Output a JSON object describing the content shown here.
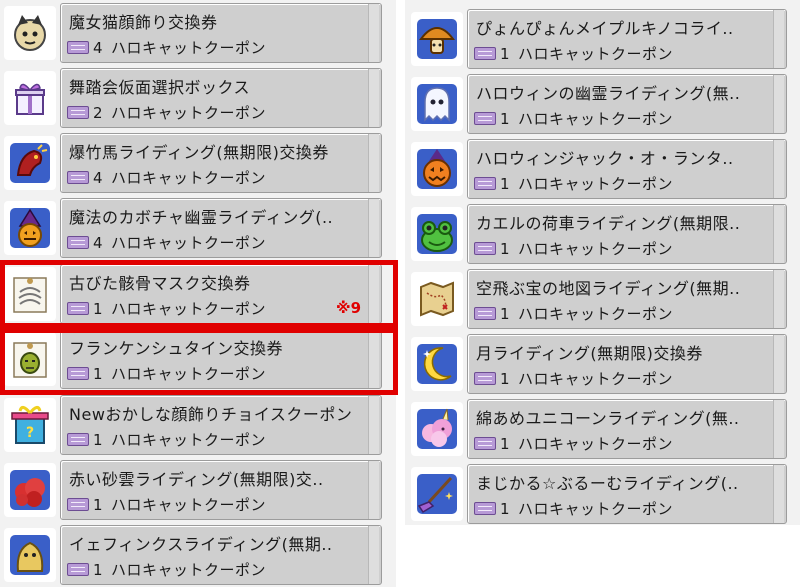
{
  "left_column": {
    "items": [
      {
        "name": "魔女猫顔飾り交換券",
        "qty": "4",
        "currency": "ハロキャットクーポン",
        "icon": "cat-face-icon"
      },
      {
        "name": "舞踏会仮面選択ボックス",
        "qty": "2",
        "currency": "ハロキャットクーポン",
        "icon": "gift-box-icon"
      },
      {
        "name": "爆竹馬ライディング(無期限)交換券",
        "qty": "4",
        "currency": "ハロキャットクーポン",
        "icon": "firecracker-horse-icon"
      },
      {
        "name": "魔法のカボチャ幽霊ライディング(..",
        "qty": "4",
        "currency": "ハロキャットクーポン",
        "icon": "pumpkin-ghost-icon"
      },
      {
        "name": "古びた骸骨マスク交換券",
        "qty": "1",
        "currency": "ハロキャットクーポン",
        "icon": "skull-ticket-icon"
      },
      {
        "name": "フランケンシュタイン交換券",
        "qty": "1",
        "currency": "ハロキャットクーポン",
        "icon": "frankenstein-ticket-icon"
      },
      {
        "name": "Newおかしな顔飾りチョイスクーポン",
        "qty": "1",
        "currency": "ハロキャットクーポン",
        "icon": "mystery-box-icon"
      },
      {
        "name": "赤い砂雲ライディング(無期限)交..",
        "qty": "1",
        "currency": "ハロキャットクーポン",
        "icon": "red-cloud-icon"
      },
      {
        "name": "イェフィンクスライディング(無期..",
        "qty": "1",
        "currency": "ハロキャットクーポン",
        "icon": "sphinx-icon"
      }
    ]
  },
  "right_column": {
    "items": [
      {
        "name": "ぴょんぴょんメイプルキノコライ..",
        "qty": "1",
        "currency": "ハロキャットクーポン",
        "icon": "mushroom-icon"
      },
      {
        "name": "ハロウィンの幽霊ライディング(無..",
        "qty": "1",
        "currency": "ハロキャットクーポン",
        "icon": "ghost-icon"
      },
      {
        "name": "ハロウィンジャック・オ・ランタ..",
        "qty": "1",
        "currency": "ハロキャットクーポン",
        "icon": "jack-o-lantern-icon"
      },
      {
        "name": "カエルの荷車ライディング(無期限..",
        "qty": "1",
        "currency": "ハロキャットクーポン",
        "icon": "frog-icon"
      },
      {
        "name": "空飛ぶ宝の地図ライディング(無期..",
        "qty": "1",
        "currency": "ハロキャットクーポン",
        "icon": "treasure-map-icon"
      },
      {
        "name": "月ライディング(無期限)交換券",
        "qty": "1",
        "currency": "ハロキャットクーポン",
        "icon": "moon-icon"
      },
      {
        "name": "綿あめユニコーンライディング(無..",
        "qty": "1",
        "currency": "ハロキャットクーポン",
        "icon": "cotton-candy-unicorn-icon"
      },
      {
        "name": "まじかる☆ぶるーむライディング(..",
        "qty": "1",
        "currency": "ハロキャットクーポン",
        "icon": "magic-broom-icon"
      }
    ]
  },
  "annotation": {
    "note": "※9"
  },
  "colors": {
    "highlight": "#e00000",
    "item_panel": "#cfcfcf",
    "coupon": "#b79ad6"
  }
}
